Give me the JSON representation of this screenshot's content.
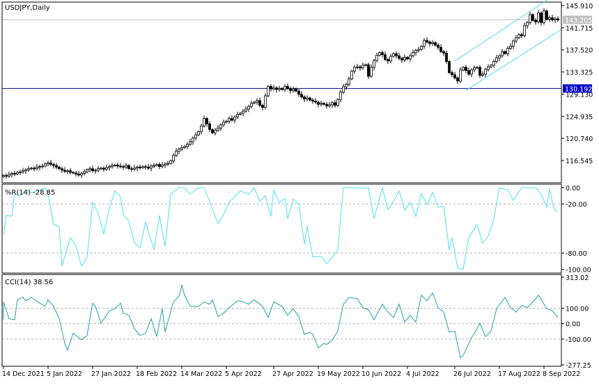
{
  "chart_data": [
    {
      "type": "candlestick",
      "title": "USDJPY,Daily",
      "symbol": "USDJPY",
      "timeframe": "Daily",
      "ylim": [
        113.2,
        146.6
      ],
      "yticks": [
        "145.910",
        "141.715",
        "137.520",
        "133.325",
        "129.130",
        "124.935",
        "120.740",
        "116.545"
      ],
      "bid_price": "143.205",
      "hline_price": "130.192",
      "closes": [
        113.7,
        113.6,
        113.9,
        114.1,
        114.0,
        114.3,
        114.4,
        114.6,
        114.8,
        115.0,
        115.1,
        115.0,
        115.3,
        115.4,
        115.5,
        115.9,
        116.1,
        115.8,
        115.6,
        115.3,
        115.0,
        114.7,
        114.5,
        114.6,
        114.3,
        114.2,
        114.0,
        113.8,
        114.1,
        114.4,
        114.8,
        115.0,
        114.6,
        114.7,
        115.0,
        115.1,
        114.9,
        115.2,
        115.4,
        115.6,
        115.7,
        115.5,
        115.4,
        115.3,
        115.6,
        115.0,
        114.9,
        115.1,
        115.3,
        115.2,
        115.4,
        115.3,
        115.1,
        115.5,
        115.6,
        115.8,
        115.4,
        115.7,
        115.9,
        116.0,
        116.5,
        117.5,
        118.3,
        118.7,
        119.0,
        119.2,
        119.6,
        120.1,
        120.8,
        121.4,
        122.0,
        123.1,
        124.5,
        123.5,
        122.4,
        121.8,
        122.3,
        122.7,
        123.3,
        123.8,
        124.0,
        124.5,
        124.2,
        124.8,
        125.3,
        125.5,
        125.9,
        126.3,
        126.8,
        127.4,
        127.6,
        127.9,
        127.0,
        126.6,
        128.8,
        130.6,
        130.1,
        130.3,
        130.0,
        130.2,
        130.0,
        130.6,
        130.2,
        129.8,
        130.1,
        129.7,
        129.1,
        128.6,
        128.2,
        128.4,
        128.0,
        127.8,
        127.6,
        127.2,
        127.4,
        127.2,
        126.9,
        127.1,
        127.5,
        127.0,
        128.1,
        129.5,
        130.5,
        131.0,
        132.0,
        133.5,
        134.2,
        134.3,
        134.1,
        134.6,
        134.7,
        132.5,
        134.2,
        135.5,
        136.5,
        137.0,
        136.6,
        135.7,
        135.4,
        136.3,
        136.8,
        136.4,
        135.9,
        135.6,
        136.1,
        135.8,
        136.4,
        137.0,
        137.4,
        137.6,
        138.2,
        139.3,
        139.0,
        138.7,
        138.9,
        138.4,
        138.0,
        137.2,
        136.9,
        135.3,
        133.2,
        132.8,
        132.2,
        131.6,
        133.7,
        134.2,
        133.6,
        132.9,
        133.7,
        134.1,
        134.2,
        132.7,
        132.9,
        133.8,
        134.3,
        134.6,
        135.3,
        136.0,
        136.4,
        137.2,
        136.8,
        137.8,
        138.2,
        139.2,
        139.8,
        140.4,
        140.2,
        142.1,
        142.7,
        144.2,
        143.1,
        142.8,
        144.5,
        142.7,
        144.9,
        143.3,
        143.6,
        143.2,
        143.4,
        143.2
      ],
      "channel": {
        "upper": [
          [
            162,
            135.4
          ],
          [
            195,
            146.9
          ]
        ],
        "lower": [
          [
            166,
            129.85
          ],
          [
            200,
            141.3
          ]
        ]
      },
      "colors": {
        "channel": "#4fd8ec",
        "hline": "#000080",
        "bid": "#c0c0c0",
        "bid_label_bg": "#c0c0c0",
        "hline_label_bg": "#0000cc"
      }
    },
    {
      "type": "line",
      "title": "%R(14) -28.85",
      "ylim": [
        -100,
        0
      ],
      "levels": [
        -20,
        -80
      ],
      "yticks": [
        "0.00",
        "-20.00",
        "-80.00",
        "-100.00"
      ],
      "color": "#4fe0ee",
      "points": [
        [
          0,
          -58
        ],
        [
          1,
          -34
        ],
        [
          3,
          -35
        ],
        [
          4,
          -8
        ],
        [
          6,
          -10
        ],
        [
          8,
          -3
        ],
        [
          10,
          -6
        ],
        [
          13,
          -3
        ],
        [
          15,
          0
        ],
        [
          16,
          -8
        ],
        [
          18,
          -45
        ],
        [
          20,
          -48
        ],
        [
          21,
          -96
        ],
        [
          24,
          -61
        ],
        [
          26,
          -71
        ],
        [
          28,
          -96
        ],
        [
          30,
          -85
        ],
        [
          32,
          -18
        ],
        [
          34,
          -31
        ],
        [
          36,
          -57
        ],
        [
          38,
          -25
        ],
        [
          40,
          -4
        ],
        [
          42,
          -11
        ],
        [
          43,
          -33
        ],
        [
          45,
          -41
        ],
        [
          47,
          -67
        ],
        [
          49,
          -74
        ],
        [
          51,
          -42
        ],
        [
          54,
          -76
        ],
        [
          56,
          -34
        ],
        [
          58,
          -72
        ],
        [
          60,
          -8
        ],
        [
          63,
          0
        ],
        [
          65,
          0
        ],
        [
          67,
          -8
        ],
        [
          70,
          0
        ],
        [
          72,
          0
        ],
        [
          74,
          -17
        ],
        [
          77,
          -44
        ],
        [
          79,
          -33
        ],
        [
          81,
          -18
        ],
        [
          85,
          -4
        ],
        [
          88,
          -8
        ],
        [
          90,
          0
        ],
        [
          92,
          -17
        ],
        [
          94,
          -10
        ],
        [
          96,
          -35
        ],
        [
          97,
          -3
        ],
        [
          99,
          -18
        ],
        [
          101,
          -13
        ],
        [
          102,
          -38
        ],
        [
          104,
          -14
        ],
        [
          106,
          -20
        ],
        [
          108,
          -69
        ],
        [
          109,
          -47
        ],
        [
          111,
          -85
        ],
        [
          114,
          -84
        ],
        [
          116,
          -93
        ],
        [
          118,
          -85
        ],
        [
          120,
          -76
        ],
        [
          122,
          0
        ],
        [
          124,
          0
        ],
        [
          127,
          0
        ],
        [
          130,
          -1
        ],
        [
          131,
          0
        ],
        [
          133,
          -38
        ],
        [
          136,
          0
        ],
        [
          138,
          -27
        ],
        [
          140,
          -17
        ],
        [
          142,
          -4
        ],
        [
          144,
          -28
        ],
        [
          146,
          -18
        ],
        [
          148,
          -35
        ],
        [
          150,
          -7
        ],
        [
          152,
          -21
        ],
        [
          154,
          -6
        ],
        [
          156,
          -24
        ],
        [
          158,
          -23
        ],
        [
          160,
          -76
        ],
        [
          161,
          -61
        ],
        [
          163,
          -98
        ],
        [
          165,
          -100
        ],
        [
          167,
          -61
        ],
        [
          170,
          -45
        ],
        [
          172,
          -68
        ],
        [
          174,
          -59
        ],
        [
          176,
          -38
        ],
        [
          178,
          0
        ],
        [
          181,
          -3
        ],
        [
          183,
          -16
        ],
        [
          186,
          0
        ],
        [
          188,
          0
        ],
        [
          191,
          0
        ],
        [
          193,
          -8
        ],
        [
          195,
          -24
        ],
        [
          196,
          -1
        ],
        [
          197,
          -18
        ],
        [
          198,
          -28
        ],
        [
          199,
          -29
        ]
      ]
    },
    {
      "type": "line",
      "title": "CCI(14) 38.56",
      "ylim": [
        -277.25,
        313.02
      ],
      "levels": [
        100,
        0,
        -100
      ],
      "yticks": [
        "313.02",
        "100.00",
        "0.00",
        "-100.00",
        "-277.25"
      ],
      "color": "#20a0a8",
      "points": [
        [
          0,
          25
        ],
        [
          0,
          141
        ],
        [
          2,
          32
        ],
        [
          4,
          25
        ],
        [
          5,
          155
        ],
        [
          7,
          170
        ],
        [
          8,
          148
        ],
        [
          10,
          170
        ],
        [
          13,
          133
        ],
        [
          15,
          112
        ],
        [
          16,
          155
        ],
        [
          18,
          112
        ],
        [
          20,
          32
        ],
        [
          22,
          -128
        ],
        [
          23,
          -171
        ],
        [
          25,
          -62
        ],
        [
          27,
          -91
        ],
        [
          28,
          -106
        ],
        [
          30,
          -77
        ],
        [
          32,
          133
        ],
        [
          33,
          112
        ],
        [
          35,
          3
        ],
        [
          38,
          83
        ],
        [
          40,
          97
        ],
        [
          42,
          133
        ],
        [
          43,
          68
        ],
        [
          45,
          54
        ],
        [
          47,
          -33
        ],
        [
          49,
          -77
        ],
        [
          51,
          -62
        ],
        [
          53,
          32
        ],
        [
          55,
          -84
        ],
        [
          57,
          97
        ],
        [
          58,
          -55
        ],
        [
          61,
          141
        ],
        [
          63,
          177
        ],
        [
          64,
          249
        ],
        [
          65,
          184
        ],
        [
          67,
          112
        ],
        [
          70,
          112
        ],
        [
          72,
          141
        ],
        [
          74,
          126
        ],
        [
          75,
          155
        ],
        [
          77,
          46
        ],
        [
          79,
          68
        ],
        [
          81,
          104
        ],
        [
          84,
          148
        ],
        [
          86,
          141
        ],
        [
          88,
          126
        ],
        [
          90,
          155
        ],
        [
          93,
          112
        ],
        [
          95,
          39
        ],
        [
          97,
          141
        ],
        [
          100,
          112
        ],
        [
          102,
          54
        ],
        [
          104,
          97
        ],
        [
          106,
          46
        ],
        [
          108,
          -70
        ],
        [
          110,
          -55
        ],
        [
          111,
          -70
        ],
        [
          113,
          -157
        ],
        [
          115,
          -128
        ],
        [
          116,
          -135
        ],
        [
          118,
          -106
        ],
        [
          120,
          -48
        ],
        [
          122,
          126
        ],
        [
          124,
          170
        ],
        [
          127,
          162
        ],
        [
          129,
          104
        ],
        [
          131,
          90
        ],
        [
          133,
          25
        ],
        [
          136,
          126
        ],
        [
          138,
          75
        ],
        [
          140,
          39
        ],
        [
          142,
          126
        ],
        [
          144,
          10
        ],
        [
          146,
          54
        ],
        [
          148,
          10
        ],
        [
          150,
          184
        ],
        [
          152,
          148
        ],
        [
          154,
          199
        ],
        [
          156,
          104
        ],
        [
          158,
          75
        ],
        [
          160,
          -55
        ],
        [
          162,
          -48
        ],
        [
          164,
          -222
        ],
        [
          165,
          -207
        ],
        [
          168,
          -91
        ],
        [
          170,
          -33
        ],
        [
          171,
          3
        ],
        [
          173,
          -84
        ],
        [
          175,
          -48
        ],
        [
          177,
          97
        ],
        [
          180,
          170
        ],
        [
          182,
          104
        ],
        [
          184,
          75
        ],
        [
          186,
          119
        ],
        [
          188,
          104
        ],
        [
          190,
          141
        ],
        [
          192,
          184
        ],
        [
          195,
          97
        ],
        [
          197,
          83
        ],
        [
          198,
          61
        ],
        [
          199,
          39
        ]
      ]
    }
  ],
  "x_axis": {
    "labels": [
      {
        "bar": 0,
        "text": "14 Dec 2021"
      },
      {
        "bar": 16,
        "text": "5 Jan 2022"
      },
      {
        "bar": 32,
        "text": "27 Jan 2022"
      },
      {
        "bar": 48,
        "text": "18 Feb 2022"
      },
      {
        "bar": 64,
        "text": "14 Mar 2022"
      },
      {
        "bar": 80,
        "text": "5 Apr 2022"
      },
      {
        "bar": 97,
        "text": "27 Apr 2022"
      },
      {
        "bar": 113,
        "text": "19 May 2022"
      },
      {
        "bar": 129,
        "text": "10 Jun 2022"
      },
      {
        "bar": 145,
        "text": "4 Jul 2022"
      },
      {
        "bar": 162,
        "text": "26 Jul 2022"
      },
      {
        "bar": 178,
        "text": "17 Aug 2022"
      },
      {
        "bar": 194,
        "text": "8 Sep 2022"
      }
    ]
  }
}
